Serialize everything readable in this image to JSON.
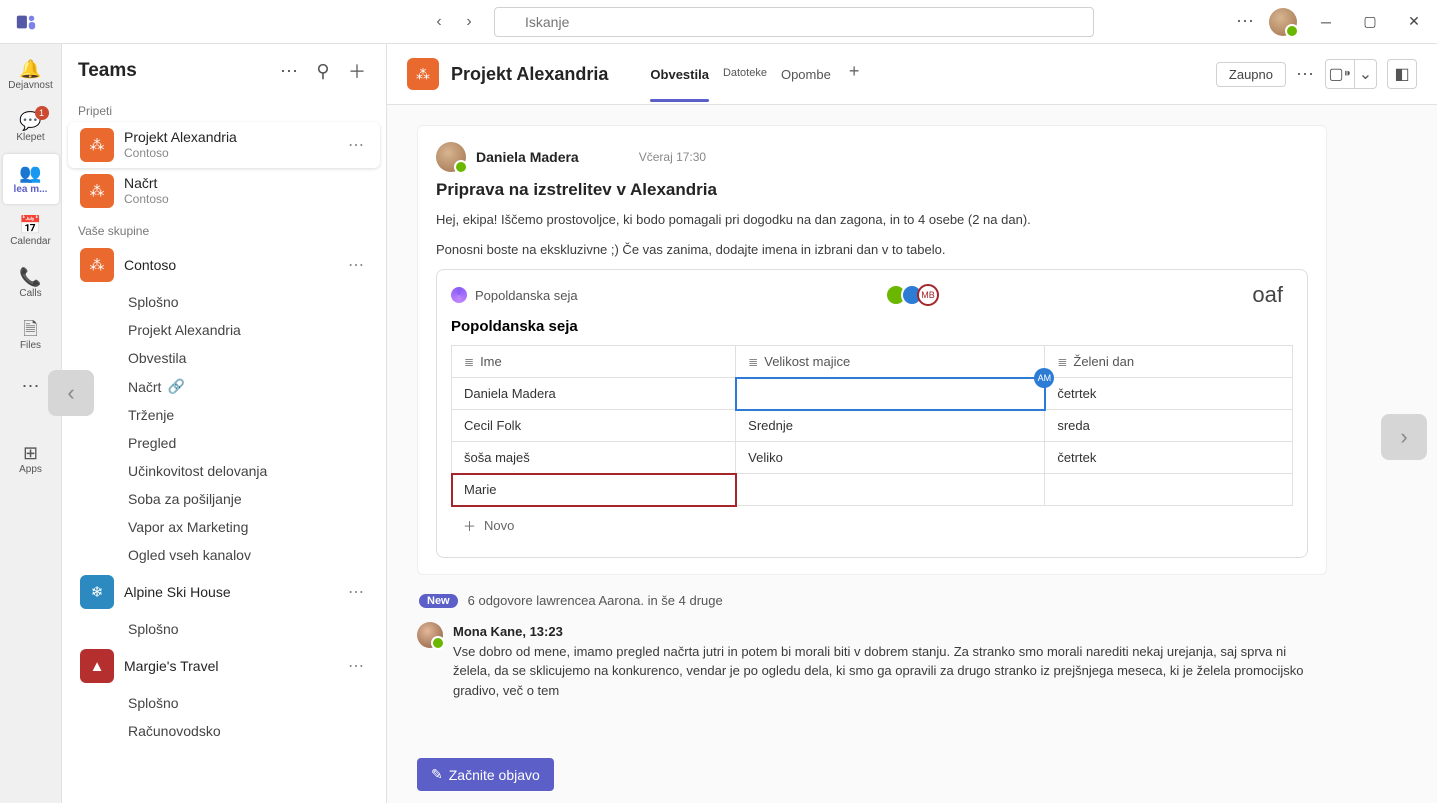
{
  "titlebar": {
    "search_placeholder": "Iskanje"
  },
  "rail": {
    "activity": "Dejavnost",
    "chat": "Klepet",
    "chat_badge": "1",
    "teams": "lea m...",
    "calendar": "Calendar",
    "calls": "Calls",
    "files": "Files",
    "more": "...",
    "apps": "Apps"
  },
  "sidebar": {
    "title": "Teams",
    "section_pinned": "Pripeti",
    "section_yourteams": "Vaše skupine",
    "pinned": [
      {
        "name": "Projekt Alexandria",
        "sub": "Contoso"
      },
      {
        "name": "Načrt",
        "sub": "Contoso"
      }
    ],
    "teams": [
      {
        "name": "Contoso",
        "channels": [
          "Splošno",
          "Projekt Alexandria",
          "Obvestila",
          "Načrt",
          "Trženje",
          "Pregled",
          "Učinkovitost delovanja",
          "Soba za pošiljanje",
          "Vapor ax Marketing",
          "Ogled vseh kanalov"
        ]
      },
      {
        "name": "Alpine Ski House",
        "channels": [
          "Splošno"
        ]
      },
      {
        "name": "Margie's Travel",
        "channels": [
          "Splošno",
          "Računovodsko"
        ]
      }
    ]
  },
  "header": {
    "title": "Projekt Alexandria",
    "tabs": [
      "Obvestila",
      "Datoteke",
      "Opombe"
    ],
    "confidential": "Zaupno"
  },
  "post": {
    "author": "Daniela Madera",
    "time": "Včeraj 17:30",
    "title": "Priprava na izstrelitev v Alexandria",
    "line1": "Hej, ekipa! Iščemo prostovoljce, ki bodo pomagali pri dogodku na dan zagona, in to 4 osebe (2 na dan).",
    "line2": "Ponosni boste na ekskluzivne          ;) Če vas zanima, dodajte imena in izbrani dan v to tabelo."
  },
  "loop": {
    "component_name": "Popoldanska seja",
    "title": "Popoldanska seja",
    "oaf": "oaf",
    "cursors": {
      "blue": "AM",
      "red": "MB"
    },
    "columns": [
      "Ime",
      "Velikost majice",
      "Želeni dan"
    ],
    "rows": [
      {
        "ime": "Daniela Madera",
        "majica": "",
        "dan": "četrtek"
      },
      {
        "ime": "Cecil Folk",
        "majica": "Srednje",
        "dan": "sreda"
      },
      {
        "ime": "šoša maješ",
        "majica": "Veliko",
        "dan": "četrtek"
      },
      {
        "ime": "Marie",
        "majica": "",
        "dan": ""
      }
    ],
    "add_row": "Novo"
  },
  "replies": {
    "new_label": "New",
    "summary": "6 odgovore lawrencea Aarona. in še 4 druge",
    "reply1_author": "Mona Kane, 13:23",
    "reply1_text": "Vse dobro od mene, imamo pregled načrta jutri in potem bi morali biti v dobrem stanju. Za stranko smo morali narediti nekaj urejanja, saj sprva ni želela, da se sklicujemo na konkurenco, vendar je po ogledu dela, ki smo ga opravili za drugo stranko iz prejšnjega meseca, ki je želela promocijsko gradivo, več o tem"
  },
  "compose": {
    "label": "Začnite objavo"
  }
}
